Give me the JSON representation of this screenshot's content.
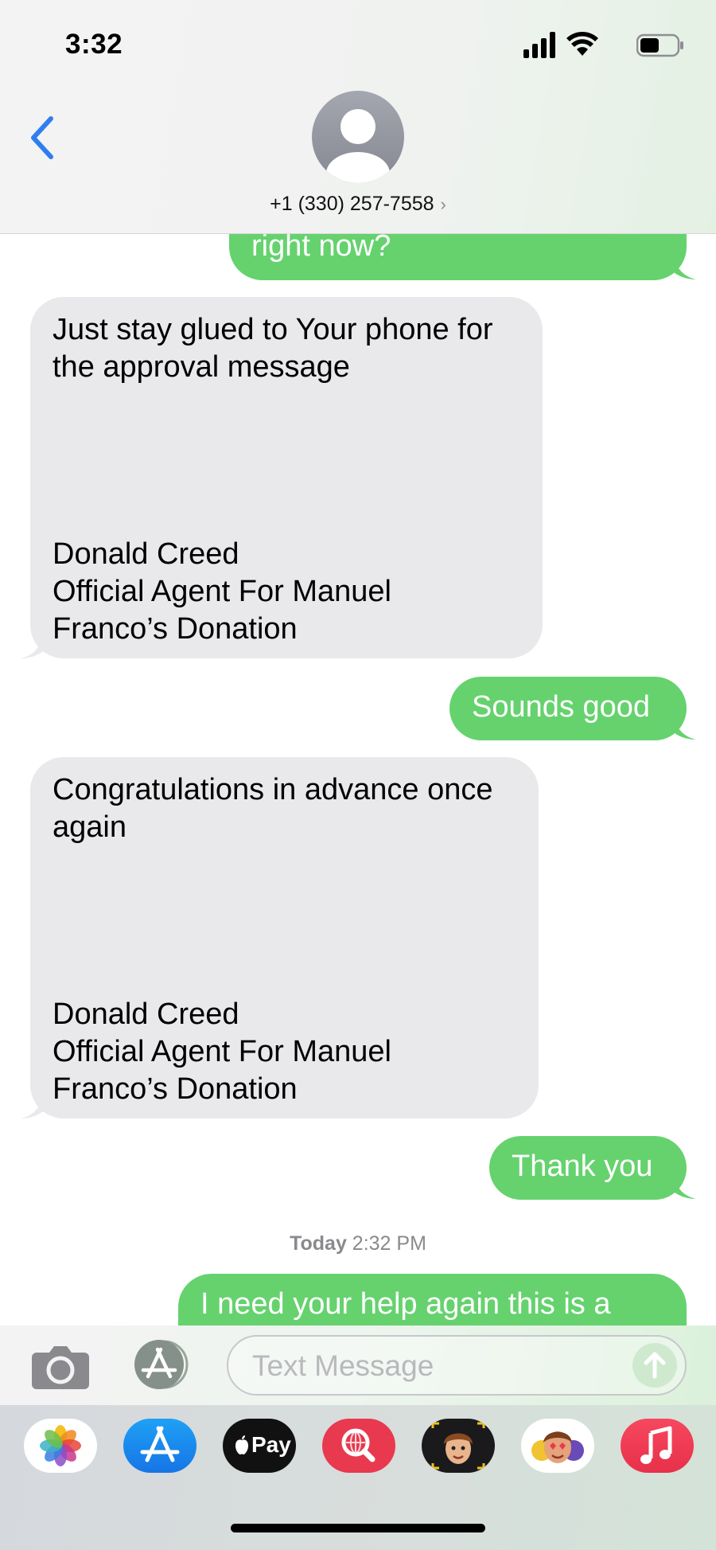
{
  "status_bar": {
    "time": "3:32"
  },
  "header": {
    "contact": "+1 (330) 257-7558",
    "chevron": "›"
  },
  "messages": [
    {
      "from": "me",
      "lines": [
        "right now?"
      ]
    },
    {
      "from": "them",
      "lines": [
        "Just stay glued to Your phone for",
        "the approval message"
      ],
      "signature": [
        "Donald Creed",
        "Official Agent For Manuel",
        "Franco’s Donation"
      ]
    },
    {
      "from": "me",
      "lines": [
        "Sounds good"
      ]
    },
    {
      "from": "them",
      "lines": [
        "Congratulations in advance once",
        "again"
      ],
      "signature": [
        "Donald Creed",
        "Official Agent For Manuel",
        "Franco’s Donation"
      ]
    },
    {
      "from": "me",
      "lines": [
        "Thank you"
      ]
    },
    {
      "from": "me",
      "lines": [
        "I need your help again this is a"
      ]
    }
  ],
  "timestamp": {
    "day": "Today",
    "time": "2:32 PM"
  },
  "input": {
    "placeholder": "Text Message"
  },
  "app_drawer": {
    "apps": [
      {
        "name": "Photos",
        "icon": "photos-icon"
      },
      {
        "name": "App Store",
        "icon": "app-store-icon"
      },
      {
        "name": "Apple Pay",
        "icon": "apple-pay-icon",
        "label": "Pay"
      },
      {
        "name": "Images",
        "icon": "image-search-icon"
      },
      {
        "name": "Memoji",
        "icon": "memoji-icon"
      },
      {
        "name": "Memoji Stickers",
        "icon": "memoji-stickers-icon"
      },
      {
        "name": "Music",
        "icon": "music-icon"
      }
    ]
  },
  "colors": {
    "outgoing_bubble": "#65d26e",
    "incoming_bubble": "#e9e9eb",
    "accent_blue": "#2f7ef0"
  }
}
